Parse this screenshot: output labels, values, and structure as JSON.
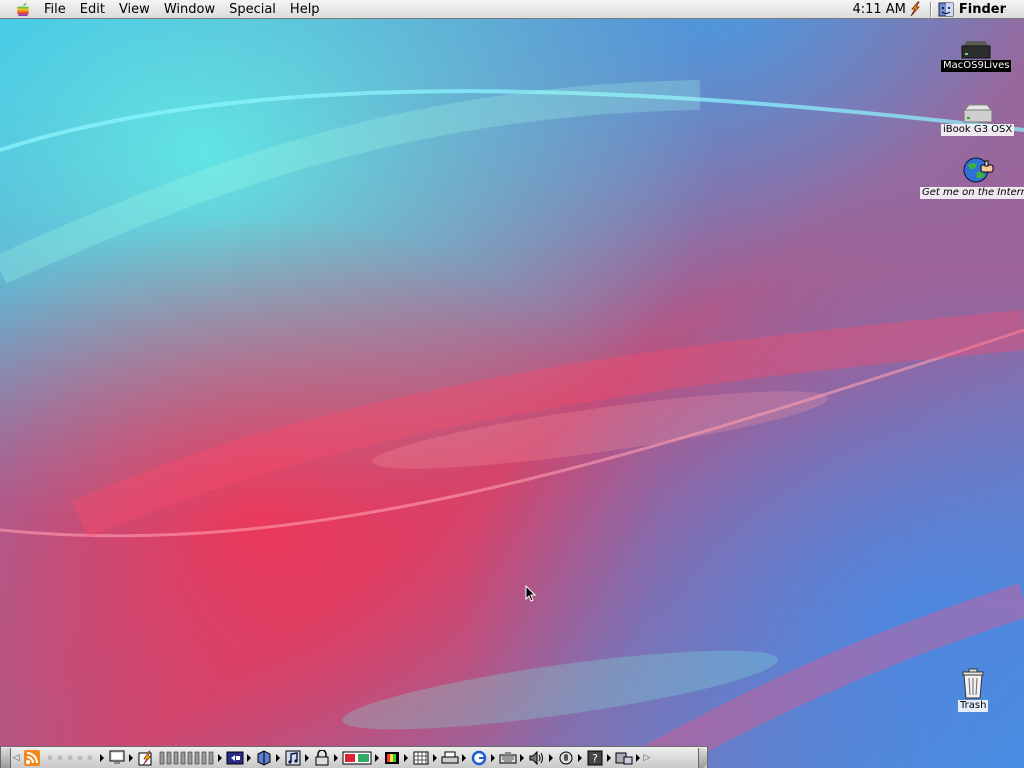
{
  "menubar": {
    "apple_icon": "apple-icon",
    "items": [
      "File",
      "Edit",
      "View",
      "Window",
      "Special",
      "Help"
    ],
    "clock": "4:11 AM",
    "app_name": "Finder"
  },
  "desktop_icons": {
    "hd1": "MacOS9Lives",
    "hd2": "iBook G3 OSX",
    "internet": "Get me on the Interne",
    "trash": "Trash"
  },
  "control_strip": {
    "modules": [
      "rss-icon",
      "apple-talk-icon",
      "monitor-icon",
      "energy-icon",
      "file-sharing-icon",
      "book-icon",
      "music-icon",
      "lock-icon",
      "web-sharing-icon",
      "color-depth-icon",
      "resolution-icon",
      "printer-icon",
      "internet-icon",
      "keyboard-icon",
      "sound-icon",
      "speech-icon",
      "help-icon",
      "remote-access-icon"
    ]
  },
  "colors": {
    "menubar": "#e8e8e8",
    "wallpaper_base": "#8a7aa8",
    "selection": "#000000"
  }
}
